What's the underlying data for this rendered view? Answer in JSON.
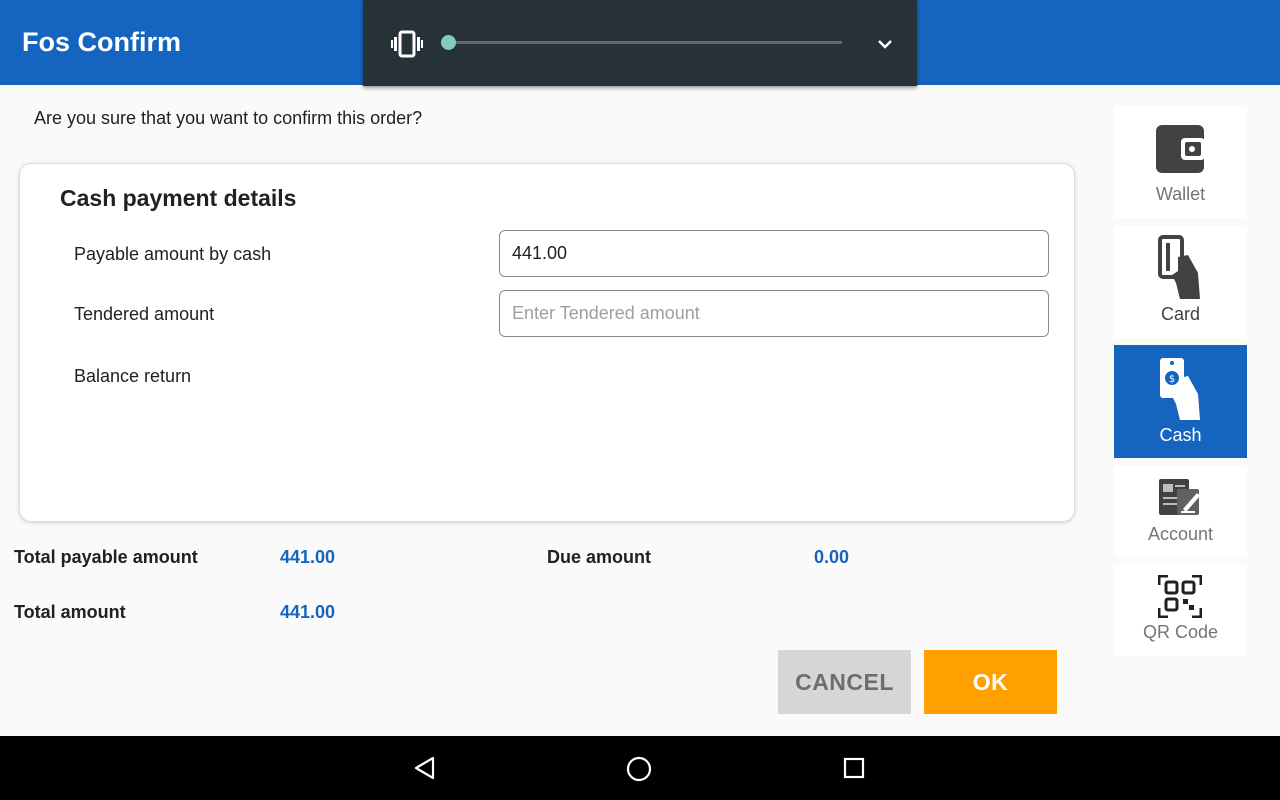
{
  "app": {
    "title": "Fos Confirm"
  },
  "volume_panel": {
    "level": 0.0,
    "icon": "vibrate-icon",
    "expand_icon": "chevron-down-icon"
  },
  "dialog": {
    "question": "Are you sure that you want to confirm this order?",
    "section_title": "Cash payment details",
    "payable_label": "Payable amount by cash",
    "payable_value": "441.00",
    "tendered_label": "Tendered amount",
    "tendered_value": "",
    "tendered_placeholder": "Enter Tendered amount",
    "balance_label": "Balance return",
    "balance_value": ""
  },
  "summary": {
    "total_payable_label": "Total payable amount",
    "total_payable_value": "441.00",
    "due_label": "Due amount",
    "due_value": "0.00",
    "total_label": "Total amount",
    "total_value": "441.00"
  },
  "buttons": {
    "cancel": "CANCEL",
    "ok": "OK"
  },
  "payment_methods": [
    {
      "label": "Wallet",
      "icon": "wallet-icon",
      "selected": false
    },
    {
      "label": "Card",
      "icon": "card-hand-icon",
      "selected": false
    },
    {
      "label": "Cash",
      "icon": "cash-hand-icon",
      "selected": true
    },
    {
      "label": "Account",
      "icon": "account-document-icon",
      "selected": false
    },
    {
      "label": "QR Code",
      "icon": "qr-code-icon",
      "selected": false
    }
  ],
  "nav": {
    "back": "back-icon",
    "home": "home-icon",
    "recents": "recents-icon"
  },
  "colors": {
    "appbar": "#1565c0",
    "accent_value": "#1565c0",
    "ok_button": "#ffa000",
    "cancel_button": "#d6d6d6",
    "volume_panel": "#263238",
    "volume_thumb": "#80cbc4"
  }
}
